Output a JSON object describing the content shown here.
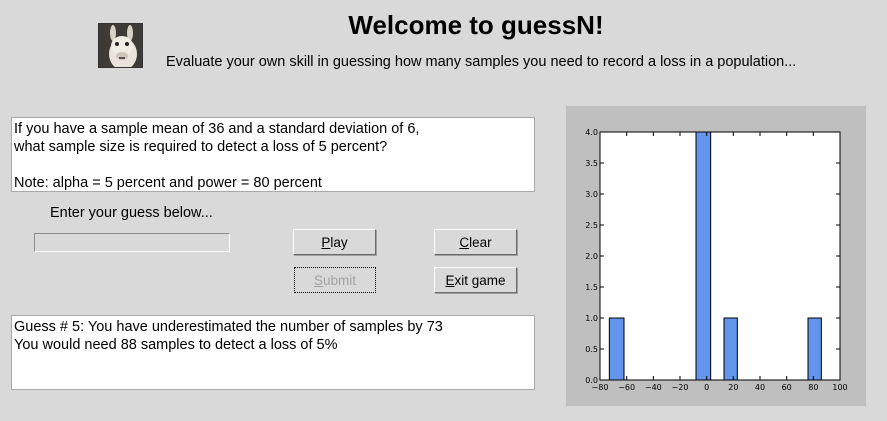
{
  "header": {
    "title": "Welcome to guessN!",
    "subtitle": "Evaluate your own skill in guessing how many samples you need to record a loss in a population..."
  },
  "question": {
    "line1": "If you have a sample mean of 36 and a standard deviation of 6,",
    "line2": "what sample size is required to detect a loss of 5 percent?",
    "line3": "Note: alpha = 5 percent and power = 80 percent"
  },
  "guess": {
    "prompt": "Enter your guess below...",
    "value": ""
  },
  "buttons": {
    "play": {
      "accel": "P",
      "rest": "lay"
    },
    "clear": {
      "accel": "C",
      "rest": "lear"
    },
    "submit": {
      "accel": "S",
      "rest": "ubmit"
    },
    "exit": {
      "accel": "E",
      "rest": "xit game"
    }
  },
  "result": {
    "line1": "Guess # 5: You have underestimated the number of samples by 73",
    "line2": "You would need 88 samples to detect a loss of 5%"
  },
  "chart_data": {
    "type": "bar",
    "title": "",
    "xlabel": "",
    "ylabel": "",
    "bar_color": "#6495ed",
    "xlim": [
      -80,
      100
    ],
    "ylim": [
      0,
      4.0
    ],
    "xticks": [
      -80,
      -60,
      -40,
      -20,
      0,
      20,
      40,
      60,
      80,
      100
    ],
    "yticks": [
      0.0,
      0.5,
      1.0,
      1.5,
      2.0,
      2.5,
      3.0,
      3.5,
      4.0
    ],
    "xtick_labels": [
      "−80",
      "−60",
      "−40",
      "−20",
      "0",
      "20",
      "40",
      "60",
      "80",
      "100"
    ],
    "ytick_labels": [
      "0.0",
      "0.5",
      "1.0",
      "1.5",
      "2.0",
      "2.5",
      "3.0",
      "3.5",
      "4.0"
    ],
    "bars": [
      {
        "x0": -73,
        "x1": -62,
        "value": 1
      },
      {
        "x0": -8,
        "x1": 3,
        "value": 4
      },
      {
        "x0": 13,
        "x1": 23,
        "value": 1
      },
      {
        "x0": 76,
        "x1": 86,
        "value": 1
      }
    ]
  }
}
